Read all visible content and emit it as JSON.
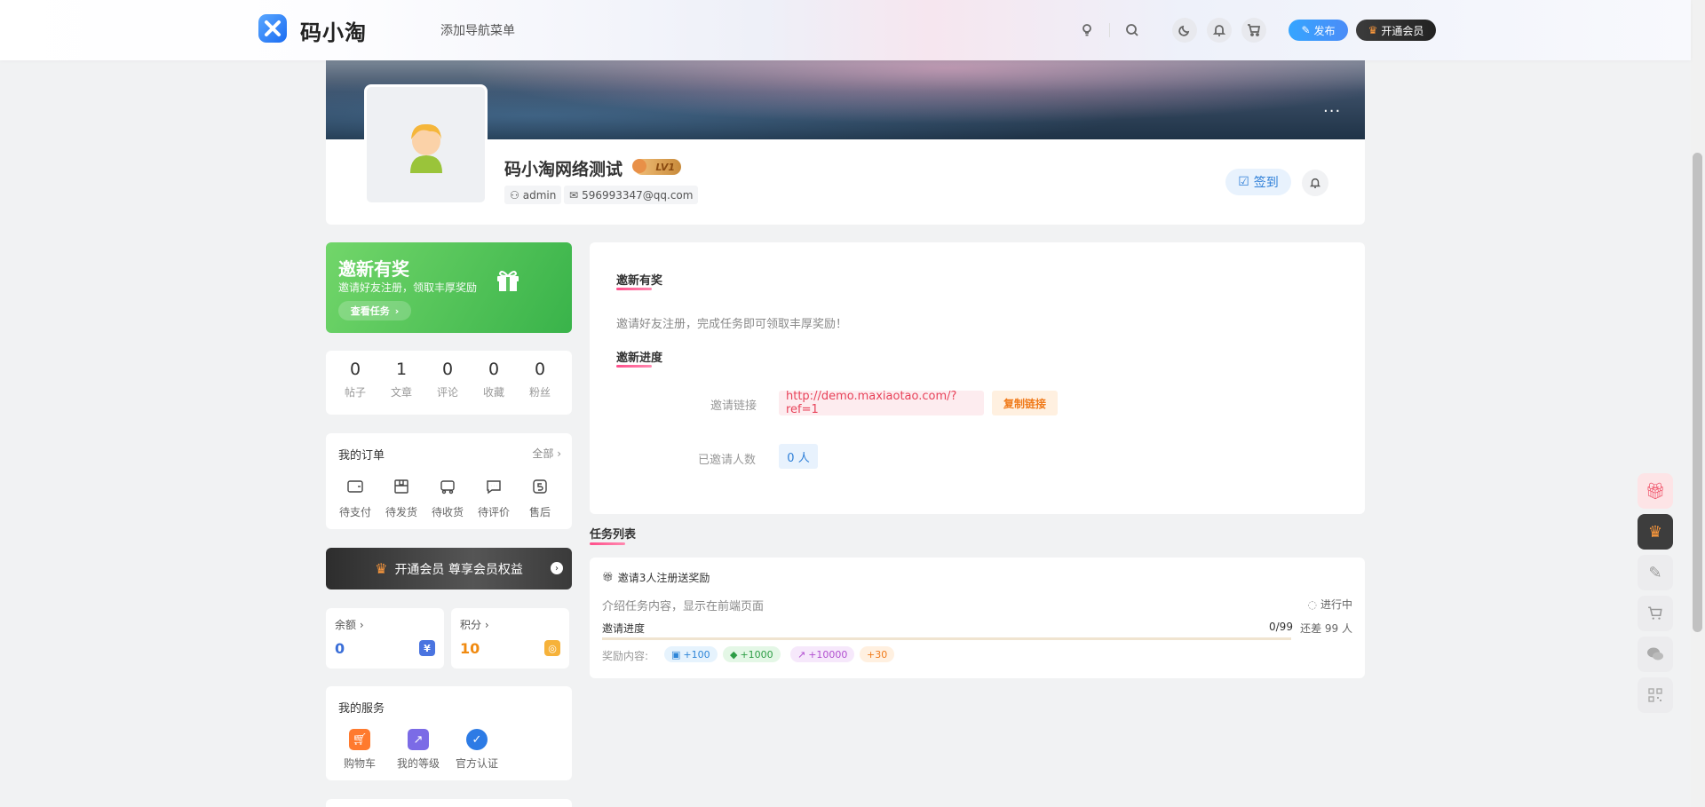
{
  "header": {
    "logo_text": "码小淘",
    "nav_add": "添加导航菜单",
    "publish_label": "发布",
    "vip_label": "开通会员"
  },
  "profile": {
    "username": "码小淘网络测试",
    "level": "LV1",
    "account": "admin",
    "email": "596993347@qq.com",
    "sign_label": "签到",
    "more": "···"
  },
  "invite_banner": {
    "title": "邀新有奖",
    "subtitle": "邀请好友注册，领取丰厚奖励",
    "button": "查看任务"
  },
  "stats": [
    {
      "value": "0",
      "label": "帖子"
    },
    {
      "value": "1",
      "label": "文章"
    },
    {
      "value": "0",
      "label": "评论"
    },
    {
      "value": "0",
      "label": "收藏"
    },
    {
      "value": "0",
      "label": "粉丝"
    }
  ],
  "orders": {
    "title": "我的订单",
    "all": "全部",
    "items": [
      {
        "label": "待支付",
        "icon": "wallet-icon"
      },
      {
        "label": "待发货",
        "icon": "package-icon"
      },
      {
        "label": "待收货",
        "icon": "truck-icon"
      },
      {
        "label": "待评价",
        "icon": "comment-icon"
      },
      {
        "label": "售后",
        "icon": "refund-icon"
      }
    ]
  },
  "vip_bar": {
    "label": "开通会员 尊享会员权益"
  },
  "balance": {
    "label": "余额",
    "value": "0",
    "color": "#3b6fd8"
  },
  "points": {
    "label": "积分",
    "value": "10",
    "color": "#f08a10"
  },
  "services": {
    "title": "我的服务",
    "items": [
      {
        "label": "购物车",
        "icon": "cart-icon",
        "color": "#ff7a2e"
      },
      {
        "label": "我的等级",
        "icon": "level-icon",
        "color": "#7b6be6"
      },
      {
        "label": "官方认证",
        "icon": "verified-icon",
        "color": "#2d7be5"
      }
    ]
  },
  "main": {
    "section1_title": "邀新有奖",
    "description": "邀请好友注册，完成任务即可领取丰厚奖励！",
    "section2_title": "邀新进度",
    "link_label": "邀请链接",
    "link_value": "http://demo.maxiaotao.com/?ref=1",
    "copy_label": "复制链接",
    "count_label": "已邀请人数",
    "count_value": "0 人"
  },
  "tasks": {
    "title": "任务列表",
    "items": [
      {
        "name": "邀请3人注册送奖励",
        "desc": "介绍任务内容，显示在前端页面",
        "status": "进行中",
        "progress_label": "邀请进度",
        "progress_value": "0/99",
        "progress_fraction": 0,
        "remain": "还差 99 人",
        "reward_label": "奖励内容:",
        "rewards": [
          "+100",
          "+1000",
          "+10000",
          "+30"
        ]
      }
    ]
  },
  "colors": {
    "accent": "#ff4f8b",
    "primary": "#2e7fd8",
    "green": "#4cc45a"
  }
}
